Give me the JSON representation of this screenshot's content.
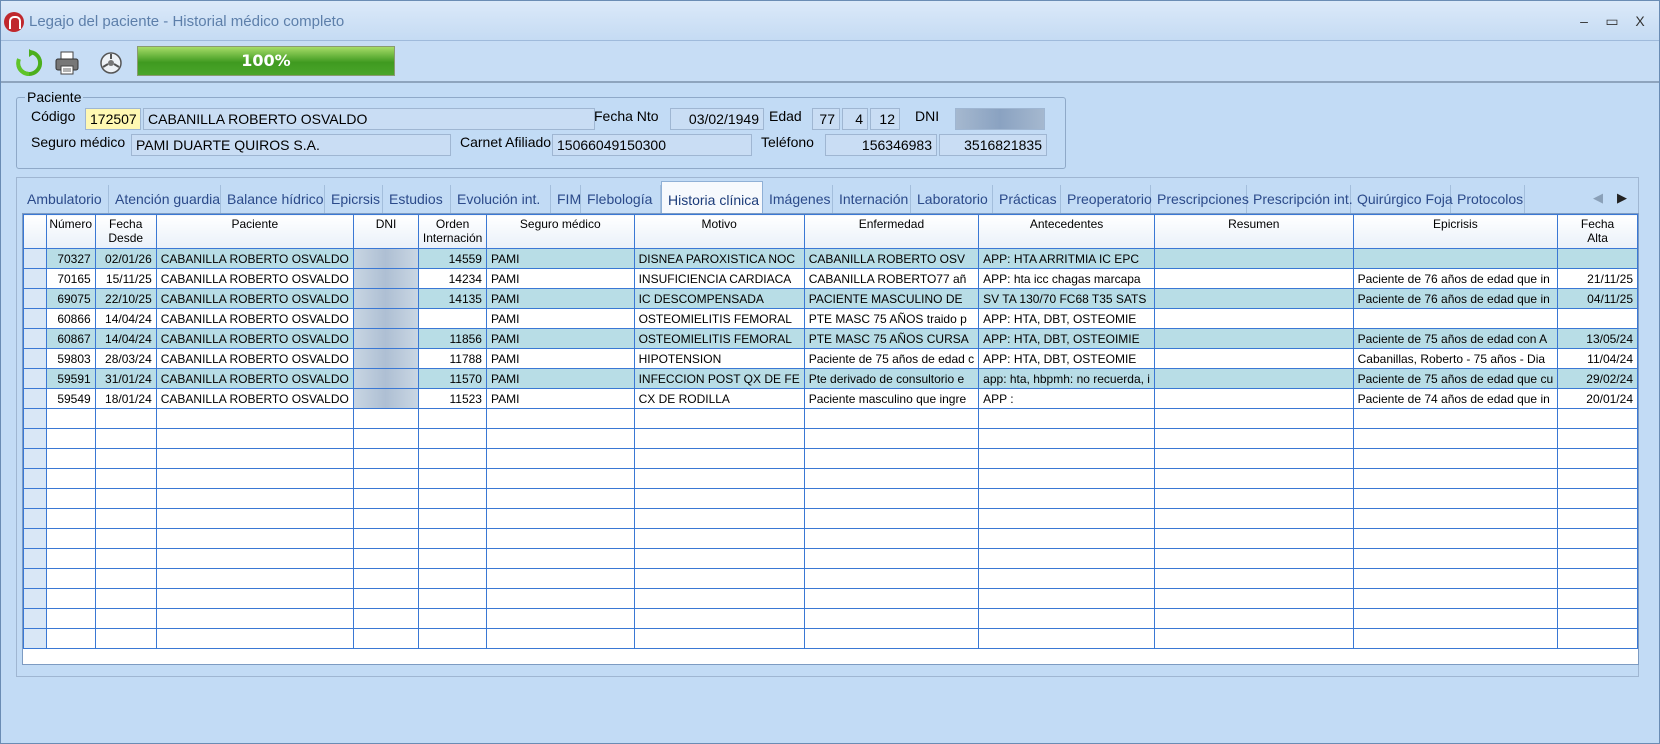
{
  "window": {
    "title": "Legajo del paciente - Historial médico completo",
    "minimize": "–",
    "maximize": "▭",
    "close": "X"
  },
  "toolbar": {
    "refresh_icon": "refresh-icon",
    "print_icon": "print-icon",
    "settings_icon": "settings-icon",
    "progress_label": "100%",
    "progress_value": 100
  },
  "patient": {
    "group_label": "Paciente",
    "codigo_label": "Código",
    "codigo": "172507",
    "nombre": "CABANILLA ROBERTO OSVALDO",
    "fecha_nto_label": "Fecha Nto",
    "fecha_nto": "03/02/1949",
    "edad_label": "Edad",
    "edad_anios": "77",
    "edad_meses": "4",
    "edad_dias": "12",
    "dni_label": "DNI",
    "dni": "",
    "seguro_label": "Seguro médico",
    "seguro": "PAMI DUARTE QUIROS S.A.",
    "carnet_label": "Carnet Afiliado",
    "carnet": "15066049150300",
    "telefono_label": "Teléfono",
    "telefono1": "156346983",
    "telefono2": "3516821835"
  },
  "tabs": [
    "Ambulatorio",
    "Atención guardia",
    "Balance hídrico",
    "Epicrsis",
    "Estudios",
    "Evolución int.",
    "FIM",
    "Flebología",
    "Historia clínica",
    "Imágenes",
    "Internación",
    "Laboratorio",
    "Prácticas",
    "Preoperatorio",
    "Prescripciones",
    "Prescripción int.",
    "Quirúrgico Foja",
    "Protocolos"
  ],
  "active_tab": "Historia clínica",
  "grid": {
    "headers": [
      "",
      "Número",
      "Fecha\nDesde",
      "Paciente",
      "DNI",
      "Orden\nInternación",
      "Seguro médico",
      "Motivo",
      "Enfermedad",
      "Antecedentes",
      "Resumen",
      "Epicrisis",
      "Fecha\nAlta"
    ],
    "rows": [
      [
        "70327",
        "02/01/26",
        "CABANILLA ROBERTO OSVALDO",
        "",
        "14559",
        "PAMI",
        "DISNEA PAROXISTICA NOC",
        "CABANILLA ROBERTO OSV",
        "APP: HTA ARRITMIA IC EPC",
        "",
        "",
        ""
      ],
      [
        "70165",
        "15/11/25",
        "CABANILLA ROBERTO OSVALDO",
        "",
        "14234",
        "PAMI",
        "INSUFICIENCIA CARDIACA",
        "CABANILLA ROBERTO77 añ",
        "APP: hta icc chagas marcapa",
        "",
        "Paciente de 76 años de edad que in",
        "21/11/25"
      ],
      [
        "69075",
        "22/10/25",
        "CABANILLA ROBERTO OSVALDO",
        "",
        "14135",
        "PAMI",
        "IC DESCOMPENSADA",
        "PACIENTE MASCULINO DE",
        "SV TA 130/70 FC68 T35 SATS",
        "",
        "Paciente de 76 años de edad que in",
        "04/11/25"
      ],
      [
        "60866",
        "14/04/24",
        "CABANILLA ROBERTO OSVALDO",
        "",
        "",
        "PAMI",
        "OSTEOMIELITIS FEMORAL",
        "PTE MASC 75 AÑOS traido p",
        "APP: HTA, DBT, OSTEOMIE",
        "",
        "",
        ""
      ],
      [
        "60867",
        "14/04/24",
        "CABANILLA ROBERTO OSVALDO",
        "",
        "11856",
        "PAMI",
        "OSTEOMIELITIS FEMORAL",
        "PTE MASC 75 AÑOS CURSA",
        "APP: HTA, DBT, OSTEOIMIE",
        "",
        "Paciente de 75 años de edad con A",
        "13/05/24"
      ],
      [
        "59803",
        "28/03/24",
        "CABANILLA ROBERTO OSVALDO",
        "",
        "11788",
        "PAMI",
        "HIPOTENSION",
        "Paciente de 75 años de edad c",
        "APP: HTA, DBT, OSTEOMIE",
        "",
        "Cabanillas, Roberto - 75 años - Dia",
        "11/04/24"
      ],
      [
        "59591",
        "31/01/24",
        "CABANILLA ROBERTO OSVALDO",
        "",
        "11570",
        "PAMI",
        "INFECCION POST QX DE FE",
        "Pte derivado de consultorio e",
        "app: hta, hbpmh: no recuerda, i",
        "",
        "Paciente de 75 años de edad que cu",
        "29/02/24"
      ],
      [
        "59549",
        "18/01/24",
        "CABANILLA ROBERTO OSVALDO",
        "",
        "11523",
        "PAMI",
        "CX DE RODILLA",
        "Paciente masculino que ingre",
        "APP :",
        "",
        "Paciente de 74 años de edad que in",
        "20/01/24"
      ]
    ]
  }
}
